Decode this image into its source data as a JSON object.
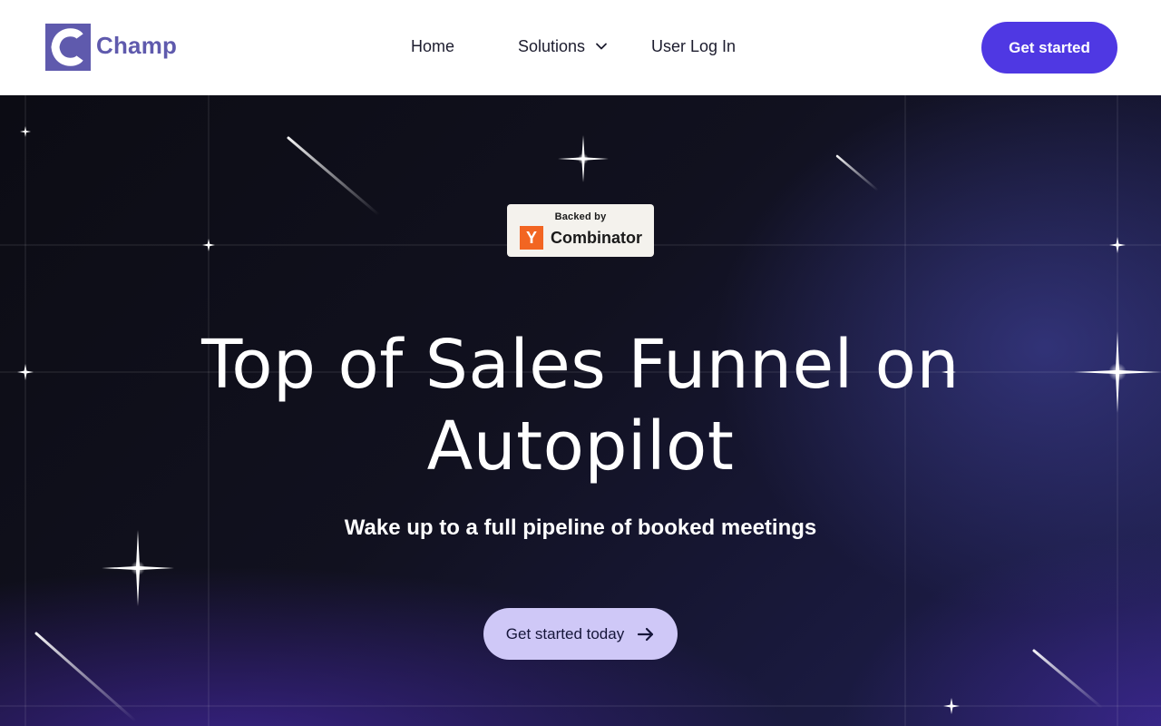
{
  "brand": {
    "name": "Champ",
    "color": "#5f5aad"
  },
  "nav": {
    "items": [
      {
        "label": "Home"
      },
      {
        "label": "Solutions",
        "icon": "chevron-down-icon"
      },
      {
        "label": "User Log In"
      }
    ],
    "cta_label": "Get started",
    "cta_color": "#4f38e3"
  },
  "hero": {
    "badge": {
      "top": "Backed by",
      "letter": "Y",
      "name": "Combinator",
      "accent": "#f26522"
    },
    "title_line1": "Top of Sales Funnel on",
    "title_line2": "Autopilot",
    "subtitle": "Wake up to a full pipeline of booked meetings",
    "cta_label": "Get started today",
    "cta_icon": "arrow-right-icon",
    "cta_color": "#cfc8f7"
  }
}
